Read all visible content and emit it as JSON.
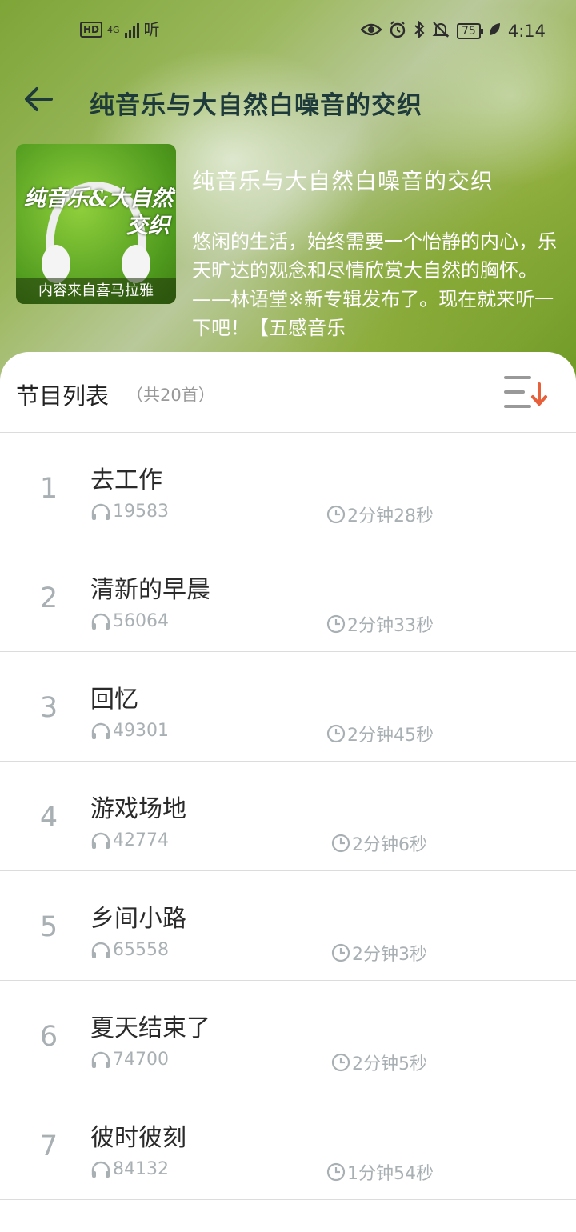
{
  "status_bar": {
    "network_badge": "HD",
    "signal_label": "4G",
    "app_label": "听",
    "battery": "75",
    "time": "4:14"
  },
  "header": {
    "back_icon": "arrow-left-icon",
    "title": "纯音乐与大自然白噪音的交织"
  },
  "album": {
    "cover_title_line1": "纯音乐&大自然",
    "cover_title_line2": "交织",
    "cover_credit": "内容来自喜马拉雅",
    "title": "纯音乐与大自然白噪音的交织",
    "description": "悠闲的生活，始终需要一个怡静的内心，乐天旷达的观念和尽情欣赏大自然的胸怀。——林语堂※新专辑发布了。现在就来听一下吧！【五感音乐"
  },
  "list": {
    "title": "节目列表",
    "count": "（共20首）",
    "sort_icon": "sort-descending-icon",
    "items": [
      {
        "num": "1",
        "title": "去工作",
        "plays": "19583",
        "duration": "2分钟28秒"
      },
      {
        "num": "2",
        "title": "清新的早晨",
        "plays": "56064",
        "duration": "2分钟33秒"
      },
      {
        "num": "3",
        "title": "回忆",
        "plays": "49301",
        "duration": "2分钟45秒"
      },
      {
        "num": "4",
        "title": "游戏场地",
        "plays": "42774",
        "duration": "2分钟6秒"
      },
      {
        "num": "5",
        "title": "乡间小路",
        "plays": "65558",
        "duration": "2分钟3秒"
      },
      {
        "num": "6",
        "title": "夏天结束了",
        "plays": "74700",
        "duration": "2分钟5秒"
      },
      {
        "num": "7",
        "title": "彼时彼刻",
        "plays": "84132",
        "duration": "1分钟54秒"
      }
    ]
  },
  "colors": {
    "accent": "#e8603a",
    "header_text": "#1e3a3a",
    "muted": "#a9b0b3"
  }
}
